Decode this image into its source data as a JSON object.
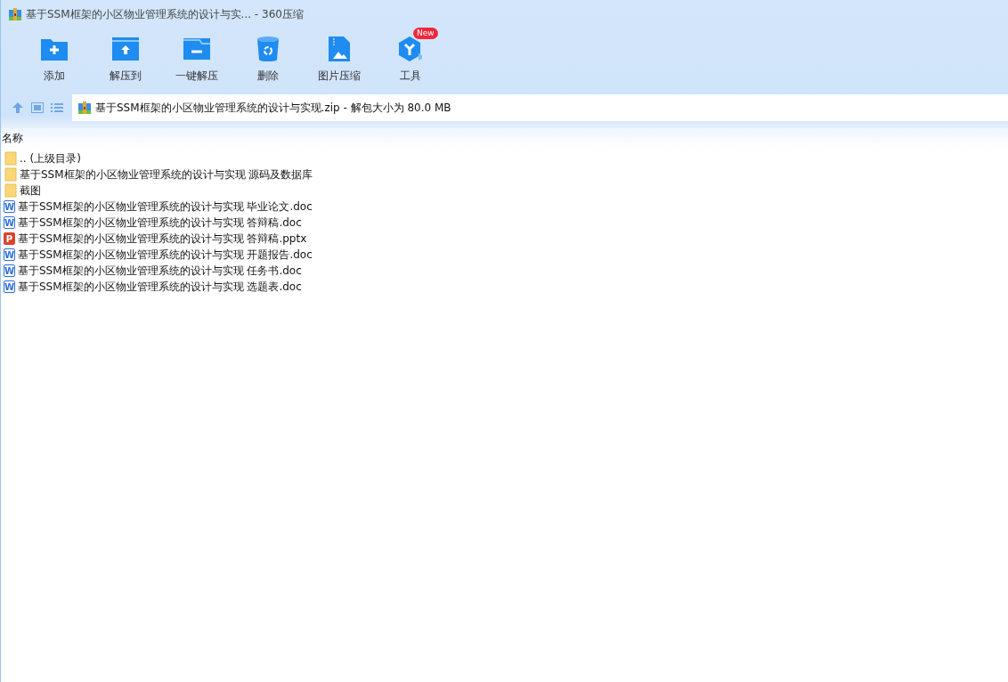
{
  "window": {
    "title": "基于SSM框架的小区物业管理系统的设计与实... - 360压缩"
  },
  "toolbar": [
    {
      "kind": "add",
      "label": "添加"
    },
    {
      "kind": "extract",
      "label": "解压到"
    },
    {
      "kind": "oneclick",
      "label": "一键解压"
    },
    {
      "kind": "delete",
      "label": "删除"
    },
    {
      "kind": "image",
      "label": "图片压缩"
    },
    {
      "kind": "tools",
      "label": "工具",
      "badge": "New"
    }
  ],
  "address": {
    "path": "基于SSM框架的小区物业管理系统的设计与实现.zip - 解包大小为 80.0 MB"
  },
  "list": {
    "columns": [
      "名称"
    ],
    "rows": [
      {
        "kind": "folder",
        "name": ".. (上级目录)"
      },
      {
        "kind": "folder",
        "name": "基于SSM框架的小区物业管理系统的设计与实现 源码及数据库"
      },
      {
        "kind": "folder",
        "name": "截图"
      },
      {
        "kind": "word",
        "icon_letter": "W",
        "name": "基于SSM框架的小区物业管理系统的设计与实现 毕业论文.doc"
      },
      {
        "kind": "word",
        "icon_letter": "W",
        "name": "基于SSM框架的小区物业管理系统的设计与实现 答辩稿.doc"
      },
      {
        "kind": "ppt",
        "icon_letter": "P",
        "name": "基于SSM框架的小区物业管理系统的设计与实现 答辩稿.pptx"
      },
      {
        "kind": "word",
        "icon_letter": "W",
        "name": "基于SSM框架的小区物业管理系统的设计与实现 开题报告.doc"
      },
      {
        "kind": "word",
        "icon_letter": "W",
        "name": "基于SSM框架的小区物业管理系统的设计与实现 任务书.doc"
      },
      {
        "kind": "word",
        "icon_letter": "W",
        "name": "基于SSM框架的小区物业管理系统的设计与实现 选题表.doc"
      }
    ]
  }
}
